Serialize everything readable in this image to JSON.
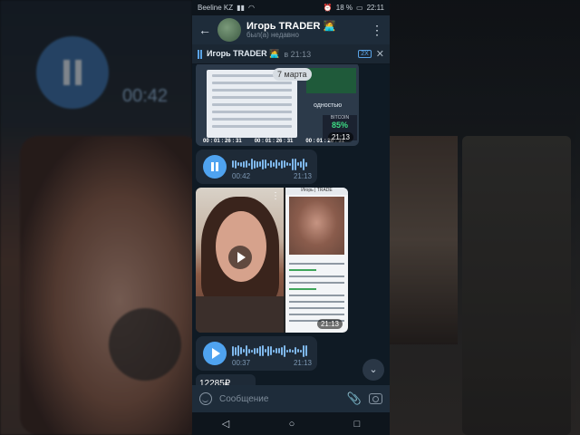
{
  "status_bar": {
    "carrier": "Beeline KZ",
    "battery": "18 %",
    "time": "22:11"
  },
  "header": {
    "contact_name": "Игорь TRADER 🧑‍💻",
    "status": "был(а) недавно",
    "back_icon": "arrow-left-icon",
    "menu_icon": "more-vertical-icon"
  },
  "pinned": {
    "title": "Игорь TRADER 🧑‍💻",
    "time": "в 21:13",
    "speed": "2X"
  },
  "media_message": {
    "date_chip": "7 марта",
    "text": "одностью",
    "btc_label": "BITCOIN",
    "btc_pct": "85%",
    "timers": [
      "00 : 01 : 26 : 31",
      "00 : 01 : 26 : 31",
      "00 : 01 : 26 : 31"
    ],
    "time": "21:13"
  },
  "voice1": {
    "duration": "00:42",
    "time": "21:13"
  },
  "album": {
    "shot_header": "Игорь | TRADE",
    "time": "21:13"
  },
  "voice2": {
    "duration": "00:37",
    "time": "21:13"
  },
  "partial_message": {
    "text": "12285₽"
  },
  "composer": {
    "placeholder": "Сообщение"
  },
  "background": {
    "left_time": "00:42"
  },
  "colors": {
    "accent": "#4fa3f0",
    "header_bg": "#1e2c3a",
    "chat_bg": "#0f1a24",
    "bubble_bg": "#1e2a37"
  }
}
